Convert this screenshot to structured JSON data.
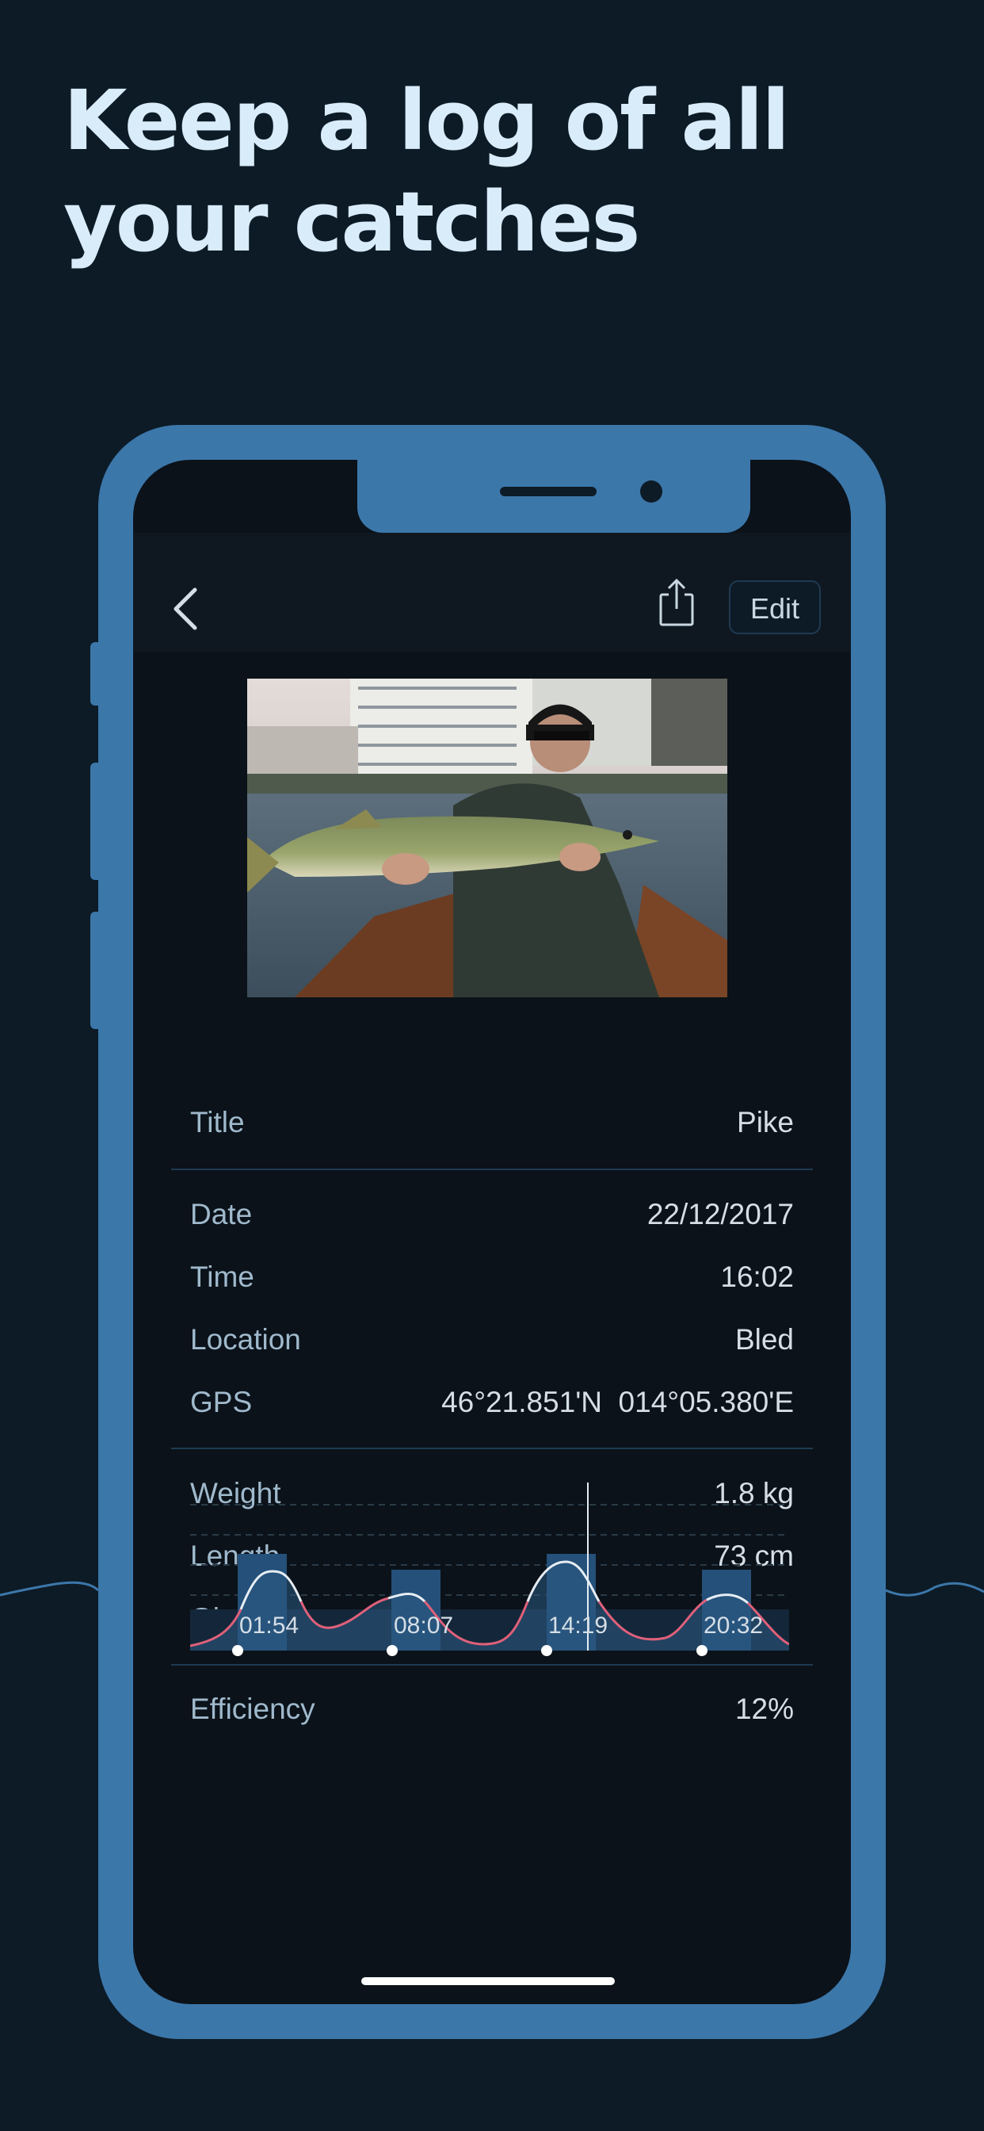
{
  "headline": "Keep a log of all your catches",
  "colors": {
    "background": "#0d1b26",
    "phone": "#3c77aa",
    "screen": "#0b1219",
    "label": "#9fb9cc",
    "value": "#d5dee6",
    "accent": "#e0607a"
  },
  "nav": {
    "back_icon": "chevron-left-icon",
    "share_icon": "share-icon",
    "edit_label": "Edit"
  },
  "photo": {
    "description_icon": "catch-photo"
  },
  "details": {
    "title": {
      "label": "Title",
      "value": "Pike"
    },
    "date": {
      "label": "Date",
      "value": "22/12/2017"
    },
    "time": {
      "label": "Time",
      "value": "16:02"
    },
    "location": {
      "label": "Location",
      "value": "Bled"
    },
    "gps": {
      "label": "GPS",
      "value": "46°21.851'N  014°05.380'E"
    },
    "weight": {
      "label": "Weight",
      "value": "1.8 kg"
    },
    "length": {
      "label": "Length",
      "value": "73 cm"
    },
    "girth": {
      "label": "Girth",
      "value": ""
    },
    "efficiency": {
      "label": "Efficiency",
      "value": "12%"
    }
  },
  "chart_data": {
    "type": "area",
    "peak_times": [
      "01:54",
      "08:07",
      "14:19",
      "20:32"
    ],
    "current_time": "16:02"
  }
}
